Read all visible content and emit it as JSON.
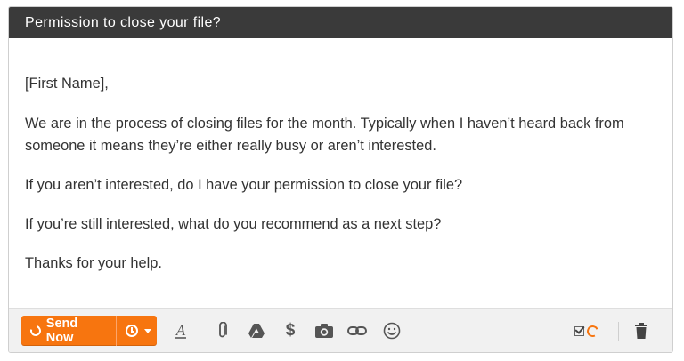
{
  "window": {
    "title": "Permission to close your file?"
  },
  "message": {
    "greeting": "[First Name],",
    "paragraphs": [
      "We are in the process of closing files for the month. Typically when I haven’t heard back from someone it means they’re either really busy or aren’t interested.",
      "If you aren’t interested, do I have your permission to close your file?",
      "If you’re still interested, what do you recommend as a next step?",
      "Thanks for your help."
    ]
  },
  "toolbar": {
    "send_label": "Send Now",
    "accent_color": "#f7750f",
    "icons": [
      "clock-icon",
      "font-format-icon",
      "paperclip-icon",
      "drive-icon",
      "dollar-icon",
      "camera-icon",
      "link-icon",
      "emoji-icon",
      "checkbox-icon",
      "tracking-icon",
      "trash-icon"
    ]
  }
}
